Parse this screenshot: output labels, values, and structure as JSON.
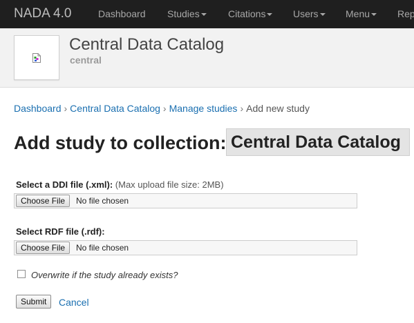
{
  "navbar": {
    "brand": "NADA 4.0",
    "items": [
      {
        "label": "Dashboard",
        "dropdown": false
      },
      {
        "label": "Studies",
        "dropdown": true
      },
      {
        "label": "Citations",
        "dropdown": true
      },
      {
        "label": "Users",
        "dropdown": true
      },
      {
        "label": "Menu",
        "dropdown": true
      },
      {
        "label": "Rep",
        "dropdown": false
      }
    ]
  },
  "header": {
    "title": "Central Data Catalog",
    "subtitle": "central",
    "thumbnail_icon": "broken-image-icon"
  },
  "breadcrumb": [
    {
      "label": "Dashboard",
      "link": true
    },
    {
      "label": "Central Data Catalog",
      "link": true
    },
    {
      "label": "Manage studies",
      "link": true
    },
    {
      "label": "Add new study",
      "link": false
    }
  ],
  "breadcrumb_separator": "›",
  "page": {
    "heading": "Add study to collection:",
    "collection_name": "Central Data Catalog"
  },
  "form": {
    "ddi": {
      "label": "Select a DDI file (.xml):",
      "hint": "(Max upload file size: 2MB)",
      "button": "Choose File",
      "status": "No file chosen"
    },
    "rdf": {
      "label": "Select RDF file (.rdf):",
      "button": "Choose File",
      "status": "No file chosen"
    },
    "overwrite": {
      "label": "Overwrite if the study already exists?",
      "checked": false
    },
    "submit_label": "Submit",
    "cancel_label": "Cancel"
  },
  "colors": {
    "navbar_bg": "#1f1f1f",
    "header_bg": "#f2f2f2",
    "link": "#1a6fb0",
    "collection_box_bg": "#e4e4e4"
  }
}
